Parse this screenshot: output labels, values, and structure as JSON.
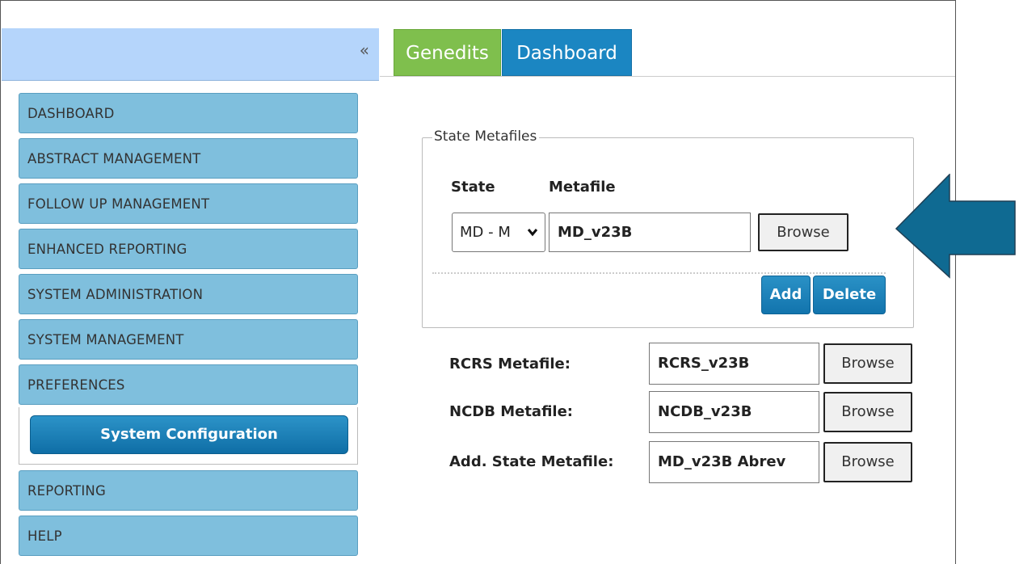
{
  "sidebar": {
    "collapse_glyph": "«",
    "items": [
      {
        "label": "DASHBOARD"
      },
      {
        "label": "ABSTRACT MANAGEMENT"
      },
      {
        "label": "FOLLOW UP MANAGEMENT"
      },
      {
        "label": "ENHANCED REPORTING"
      },
      {
        "label": "SYSTEM ADMINISTRATION"
      },
      {
        "label": "SYSTEM MANAGEMENT"
      },
      {
        "label": "PREFERENCES"
      },
      {
        "label": "REPORTING"
      },
      {
        "label": "HELP"
      }
    ],
    "sub_item": "System Configuration"
  },
  "tabs": [
    {
      "label": "Genedits",
      "color": "#7fbf4d"
    },
    {
      "label": "Dashboard",
      "color": "#1b86c2",
      "active": true
    }
  ],
  "state_metafiles": {
    "legend": "State Metafiles",
    "state_label": "State",
    "metafile_label": "Metafile",
    "state_value": "MD - M",
    "metafile_value": "MD_v23B",
    "browse_label": "Browse",
    "add_label": "Add",
    "delete_label": "Delete"
  },
  "metafiles": [
    {
      "label": "RCRS Metafile:",
      "value": "RCRS_v23B",
      "browse_label": "Browse"
    },
    {
      "label": "NCDB Metafile:",
      "value": "NCDB_v23B",
      "browse_label": "Browse"
    },
    {
      "label": "Add. State Metafile:",
      "value": "MD_v23B Abrev",
      "browse_label": "Browse"
    }
  ],
  "colors": {
    "nav_bg": "#7fbfdd",
    "sidebar_head_bg": "#b5d5fb",
    "button_blue": "#1b86c2",
    "arrow": "#0f6a92"
  },
  "icons": {
    "collapse": "double-chevron-left-icon",
    "select": "chevron-down-icon",
    "callout": "arrow-left-icon"
  }
}
